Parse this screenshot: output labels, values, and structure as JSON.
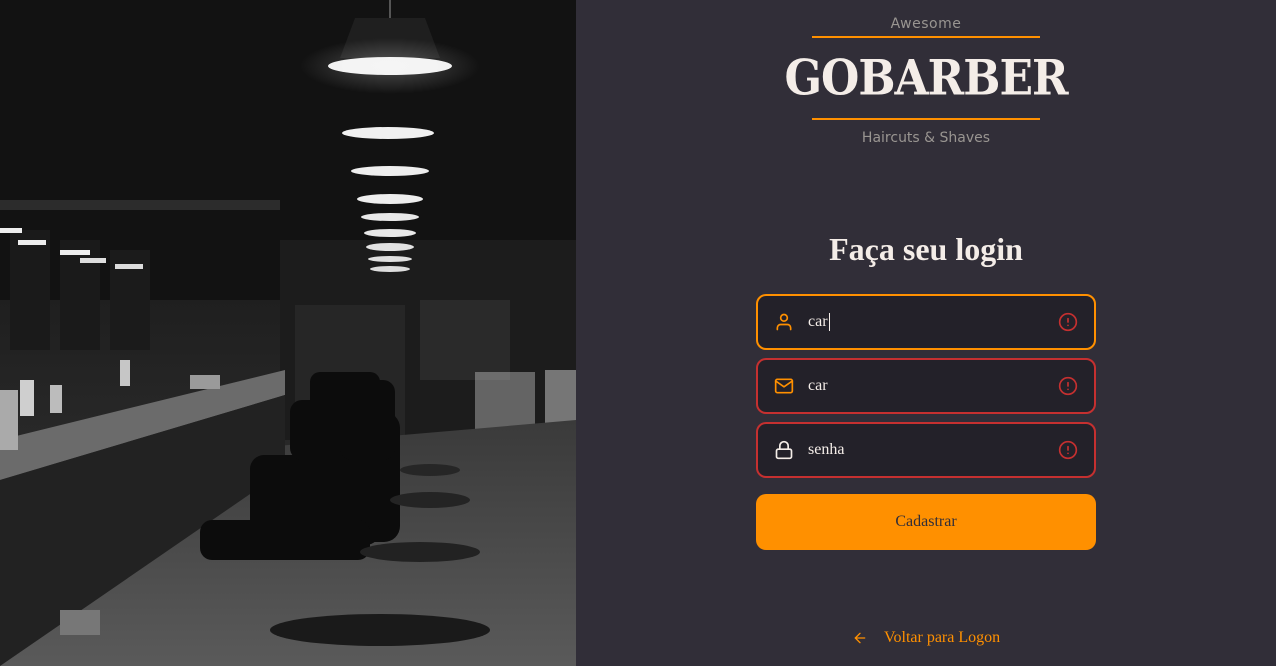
{
  "brand": {
    "top": "Awesome",
    "name": "GOBARBER",
    "bottom": "Haircuts & Shaves",
    "accent": "#ff9000",
    "error": "#c53030",
    "background": "#312e38",
    "input_background": "#232129"
  },
  "form": {
    "title": "Faça seu login",
    "fields": [
      {
        "icon": "user-icon",
        "value": "car",
        "state": "focused-error"
      },
      {
        "icon": "mail-icon",
        "value": "car",
        "state": "error"
      },
      {
        "icon": "lock-icon",
        "value": "senha",
        "state": "error"
      }
    ],
    "submit_label": "Cadastrar"
  },
  "footer": {
    "back_label": "Voltar para Logon",
    "back_icon": "arrow-left-icon"
  }
}
